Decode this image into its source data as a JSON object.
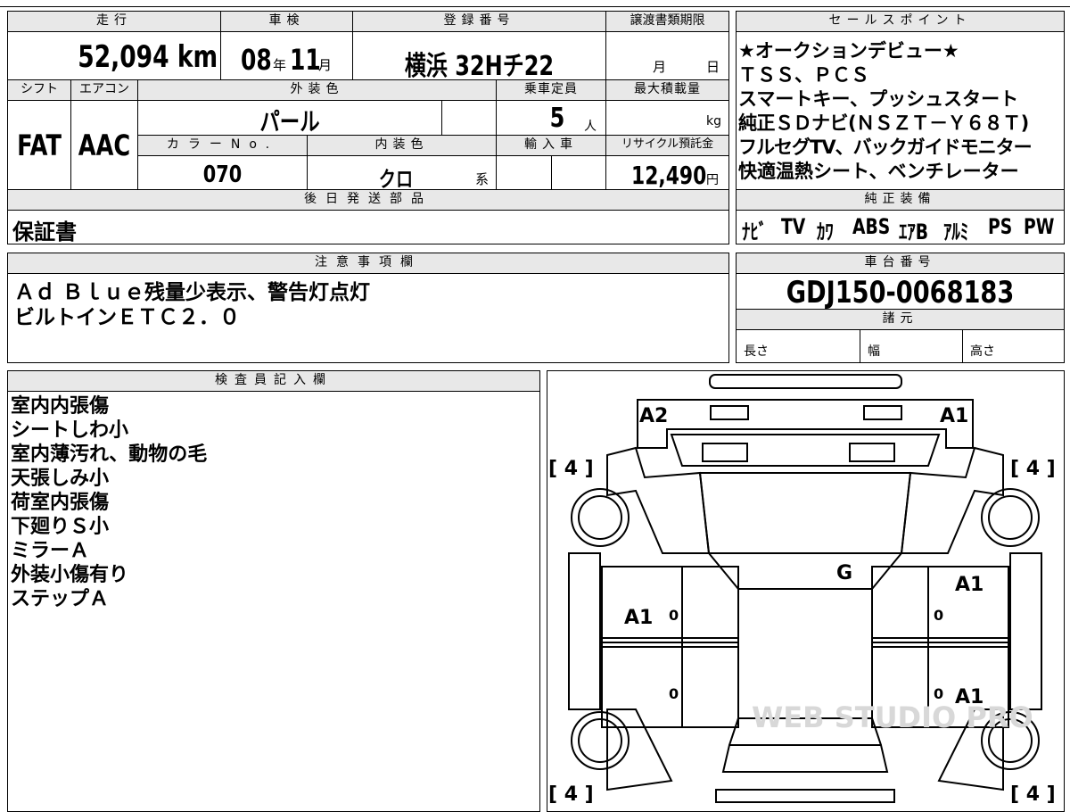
{
  "headers": {
    "mileage": "走行",
    "inspection": "車検",
    "registration": "登録番号",
    "transfer_deadline": "譲渡書類期限",
    "shift": "シフト",
    "aircon": "エアコン",
    "exterior_color": "外装色",
    "capacity": "乗車定員",
    "max_load": "最大積載量",
    "color_no": "カラーNo.",
    "interior_color": "内装色",
    "import_car": "輸入車",
    "recycle_fee": "リサイクル預託金",
    "later_parts": "後日発送部品",
    "sales_points": "セールスポイント",
    "factory_equipment": "純正装備",
    "notes": "注意事項欄",
    "chassis_no": "車台番号",
    "specs": "諸元",
    "inspector": "検査員記入欄"
  },
  "vehicle": {
    "mileage_value": "52,094",
    "mileage_unit": "km",
    "inspection_year": "08",
    "year_unit": "年",
    "inspection_month": "11",
    "month_unit": "月",
    "registration_number": "横浜 32Hチ22",
    "deadline_month": "月",
    "deadline_day": "日",
    "shift_value": "FAT",
    "aircon_value": "AAC",
    "exterior_color_value": "パール",
    "capacity_value": "5",
    "capacity_unit": "人",
    "max_load_unit": "kg",
    "color_no_value": "070",
    "interior_color_value": "クロ",
    "interior_color_suffix": "系",
    "recycle_fee_value": "12,490",
    "recycle_fee_unit": "円",
    "later_parts_value": "保証書",
    "chassis_number": "GDJ150-0068183"
  },
  "sales_points": [
    "★オークションデビュー★",
    "ＴＳＳ、ＰＣＳ",
    "スマートキー、プッシュスタート",
    "純正ＳＤナビ(ＮＳＺＴ－Ｙ６８Ｔ)",
    "フルセグTV、バックガイドモニター",
    "快適温熱シート、ベンチレーター"
  ],
  "equipment": [
    "ﾅﾋﾞ",
    "TV",
    "ｶﾜ",
    "ABS",
    "ｴｱB",
    "ｱﾙﾐ",
    "PS",
    "PW"
  ],
  "notes_lines": [
    "Ａｄ Ｂｌｕｅ残量少表示、警告灯点灯",
    "ビルトインＥＴＣ２．０"
  ],
  "specs": {
    "length": "長さ",
    "width": "幅",
    "height": "高さ"
  },
  "inspector_notes": [
    "室内内張傷",
    "シートしわ小",
    "室内薄汚れ、動物の毛",
    "天張しみ小",
    "荷室内張傷",
    "下廻りＳ小",
    "ミラーＡ",
    "外装小傷有り",
    "ステップＡ"
  ],
  "diagram": {
    "tire_fl": "[ 4 ]",
    "tire_fr": "[ 4 ]",
    "tire_rl": "[ 4 ]",
    "tire_rr": "[ 4 ]",
    "mark_front_left": "A2",
    "mark_front_right": "A1",
    "mark_windshield": "G",
    "mark_right_front_door": "A1",
    "mark_left_front_door": "A1",
    "mark_right_rear_door": "A1",
    "door_zero": "0",
    "watermark": "WEB STUDIO PRO"
  }
}
